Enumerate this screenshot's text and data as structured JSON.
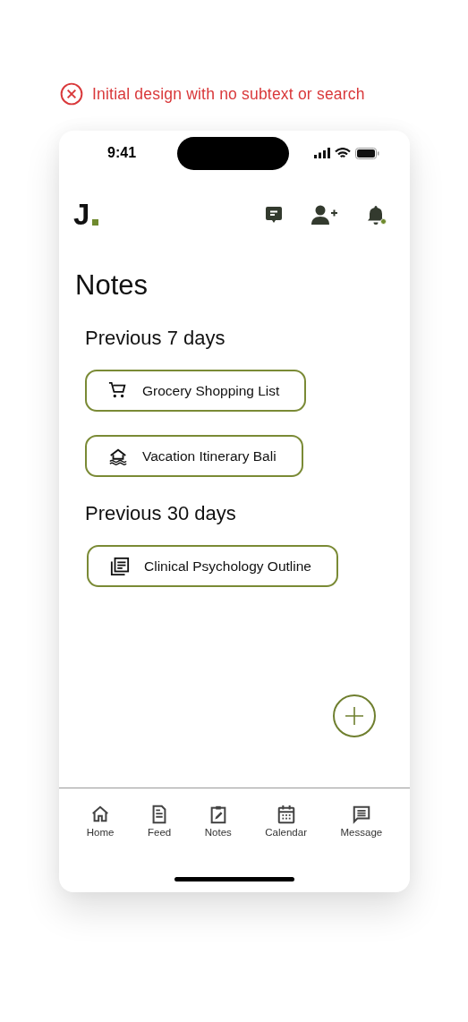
{
  "design_note": {
    "error": true,
    "text": "Initial design with no subtext or search"
  },
  "status_bar": {
    "time": "9:41"
  },
  "header": {
    "logo": "J",
    "notification_dot": true
  },
  "title": "Notes",
  "sections": [
    {
      "heading": "Previous 7 days",
      "notes": [
        {
          "kind": "cart",
          "title": "Grocery Shopping List"
        },
        {
          "kind": "house",
          "title": "Vacation Itinerary Bali"
        }
      ]
    },
    {
      "heading": "Previous 30 days",
      "notes": [
        {
          "kind": "document",
          "title": "Clinical Psychology Outline"
        }
      ]
    }
  ],
  "tab_bar": [
    {
      "kind": "home",
      "label": "Home"
    },
    {
      "kind": "feed",
      "label": "Feed"
    },
    {
      "kind": "notes",
      "label": "Notes"
    },
    {
      "kind": "calendar",
      "label": "Calendar"
    },
    {
      "kind": "message",
      "label": "Message"
    }
  ]
}
